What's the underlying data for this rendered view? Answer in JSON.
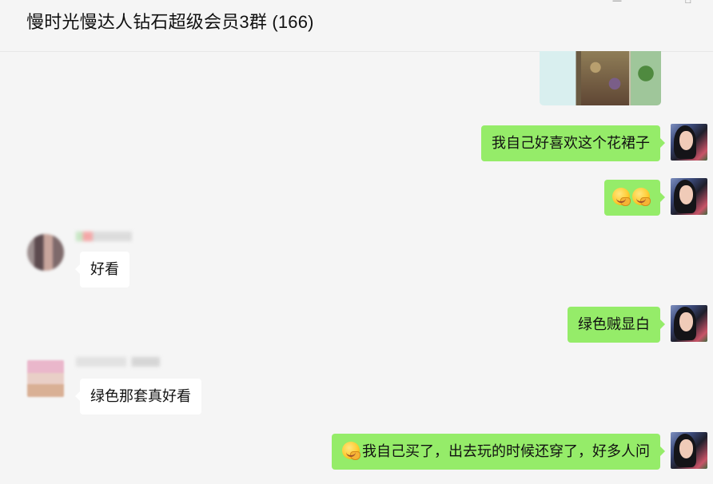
{
  "window": {
    "title": "慢时光慢达人钻石超级会员3群 (166)"
  },
  "messages": [
    {
      "sender": "me",
      "kind": "image",
      "description_icon": "photo"
    },
    {
      "sender": "me",
      "kind": "text",
      "text": "我自己好喜欢这个花裙子"
    },
    {
      "sender": "me",
      "kind": "emoji",
      "emoji_icons": [
        "hugging-face-icon",
        "hugging-face-icon"
      ]
    },
    {
      "sender": "other",
      "kind": "text",
      "text": "好看"
    },
    {
      "sender": "me",
      "kind": "text",
      "text": "绿色贼显白"
    },
    {
      "sender": "other",
      "kind": "text",
      "text": "绿色那套真好看"
    },
    {
      "sender": "me",
      "kind": "text",
      "leading_emoji": "hugging-face-icon",
      "text": "我自己买了，出去玩的时候还穿了，好多人问"
    }
  ],
  "colors": {
    "my_bubble": "#95ec69",
    "other_bubble": "#ffffff",
    "chat_bg": "#f5f5f5"
  }
}
